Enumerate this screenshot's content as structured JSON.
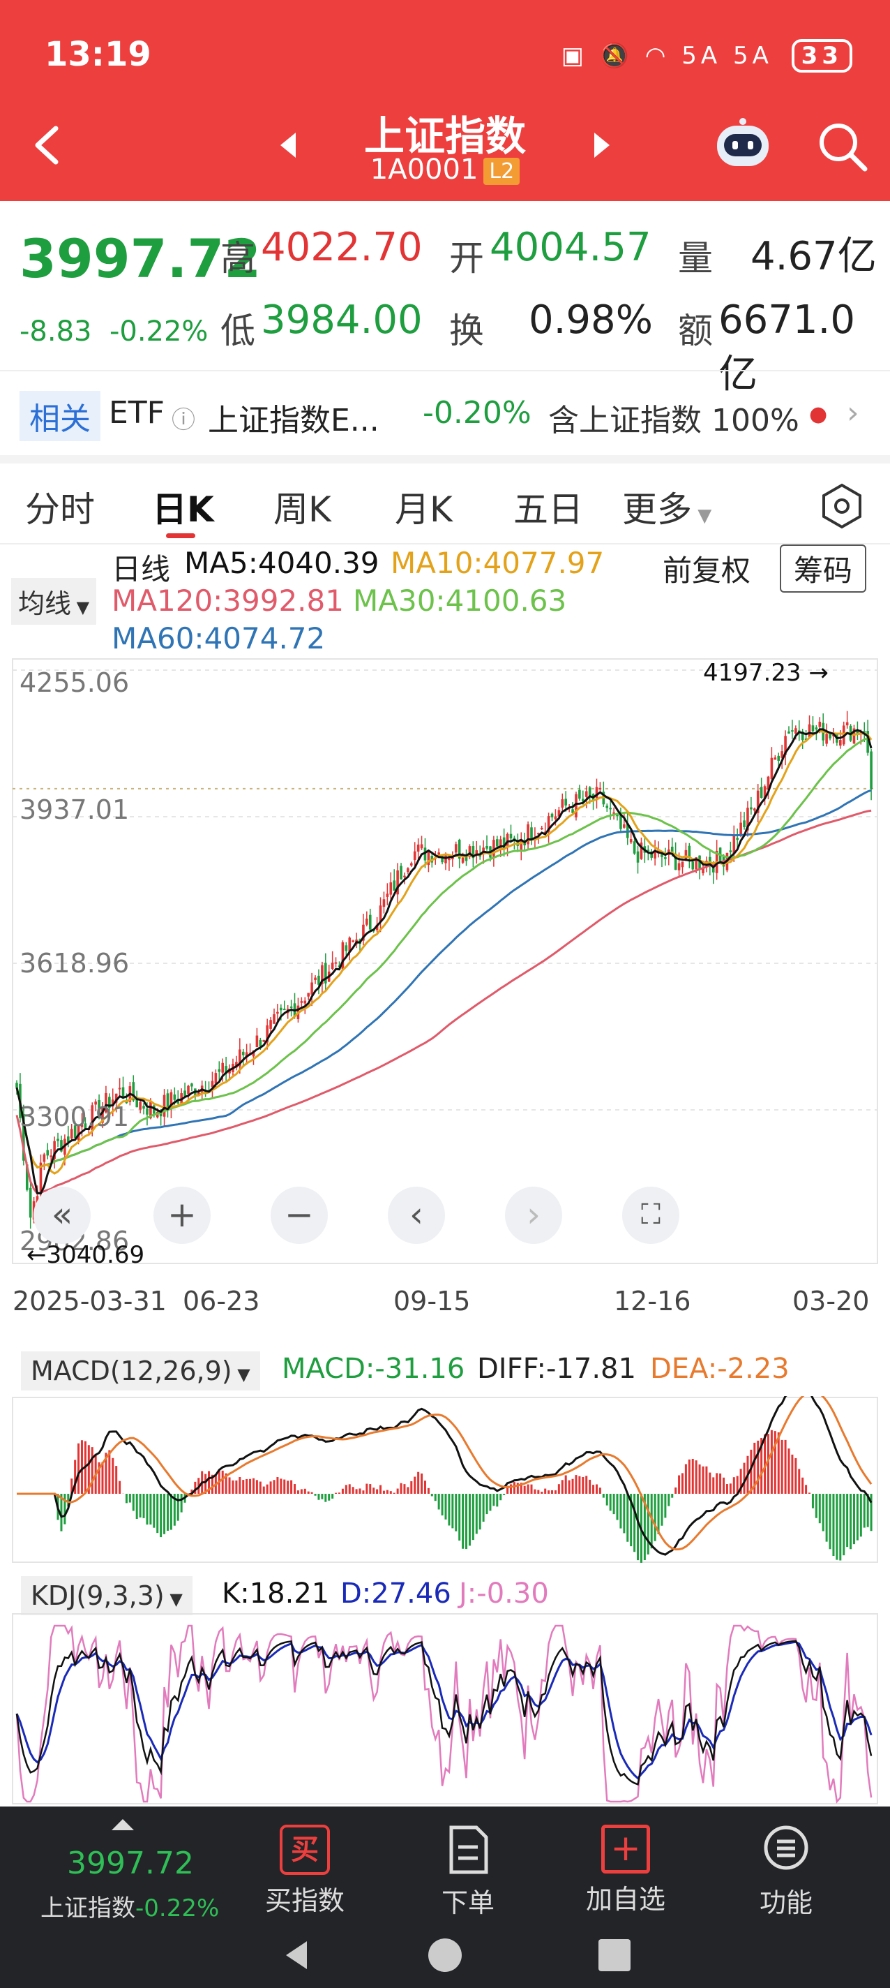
{
  "status": {
    "time": "13:19",
    "signal": "5A 5A",
    "battery": "33"
  },
  "header": {
    "title": "上证指数",
    "code": "1A0001",
    "badge": "L2"
  },
  "quote": {
    "price": "3997.72",
    "change": "-8.83",
    "change_pct": "-0.22%",
    "high_label": "高",
    "high": "4022.70",
    "open_label": "开",
    "open": "4004.57",
    "vol_label": "量",
    "vol": "4.67亿",
    "low_label": "低",
    "low": "3984.00",
    "turn_label": "换",
    "turn": "0.98%",
    "amt_label": "额",
    "amt": "6671.0亿"
  },
  "etf": {
    "tag": "相关",
    "etf_label": "ETF",
    "name": "上证指数E...",
    "pct": "-0.20%",
    "contains": "含上证指数 100%"
  },
  "tabs": [
    {
      "label": "分时"
    },
    {
      "label": "日K"
    },
    {
      "label": "周K"
    },
    {
      "label": "月K"
    },
    {
      "label": "五日"
    },
    {
      "label": "更多"
    }
  ],
  "ma_legend": {
    "period": "日线",
    "mode": "均线",
    "ma5": "MA5:4040.39",
    "ma10": "MA10:4077.97",
    "ma120": "MA120:3992.81",
    "ma30": "MA30:4100.63",
    "ma60": "MA60:4074.72",
    "fuquan": "前复权",
    "chouma": "筹码"
  },
  "kline": {
    "y_labels": [
      "4255.06",
      "3937.01",
      "3618.96",
      "3300.91",
      "2982.86"
    ],
    "high_mark": "4197.23 →",
    "low_mark": "←3040.69",
    "dates": [
      "2025-03-31",
      "06-23",
      "09-15",
      "12-16",
      "03-20"
    ]
  },
  "macd": {
    "label": "MACD(12,26,9)",
    "macd": "MACD:-31.16",
    "diff": "DIFF:-17.81",
    "dea": "DEA:-2.23"
  },
  "kdj": {
    "label": "KDJ(9,3,3)",
    "k": "K:18.21",
    "d": "D:27.46",
    "j": "J:-0.30"
  },
  "bottom": {
    "price": "3997.72",
    "name": "上证指数",
    "pct": "-0.22%",
    "buy": "买指数",
    "order": "下单",
    "add": "加自选",
    "func": "功能"
  },
  "colors": {
    "up": "#e23434",
    "down": "#1e9e3f",
    "header": "#ee3f3f",
    "ma5": "#111111",
    "ma10": "#e3a21a",
    "ma30": "#6cc24a",
    "ma60": "#2f74b5",
    "ma120": "#e05a6a"
  }
}
